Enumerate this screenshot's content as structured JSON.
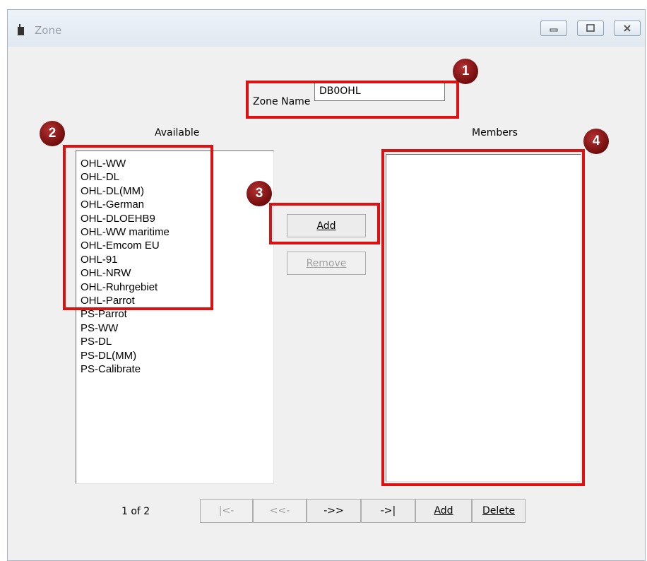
{
  "window": {
    "title": "Zone",
    "controls": {
      "minimize": "minimize",
      "maximize": "maximize",
      "close": "close"
    }
  },
  "zone_name": {
    "label": "Zone Name",
    "value": "DB0OHL"
  },
  "available": {
    "label": "Available",
    "items": [
      "OHL-WW",
      "OHL-DL",
      "OHL-DL(MM)",
      "OHL-German",
      "OHL-DLOEHB9",
      "OHL-WW maritime",
      "OHL-Emcom EU",
      "OHL-91",
      "OHL-NRW",
      "OHL-Ruhrgebiet",
      "OHL-Parrot",
      "PS-Parrot",
      "PS-WW",
      "PS-DL",
      "PS-DL(MM)",
      "PS-Calibrate"
    ]
  },
  "members": {
    "label": "Members",
    "items": []
  },
  "buttons": {
    "add": "Add",
    "remove": "Remove"
  },
  "pager": {
    "status": "1 of 2",
    "first": "|<-",
    "prev": "<<-",
    "next": "->>",
    "last": "->|",
    "add": "Add",
    "delete": "Delete"
  },
  "callouts": [
    "1",
    "2",
    "3",
    "4"
  ],
  "colors": {
    "highlight": "#dd1111",
    "badge": "#8b1414"
  }
}
